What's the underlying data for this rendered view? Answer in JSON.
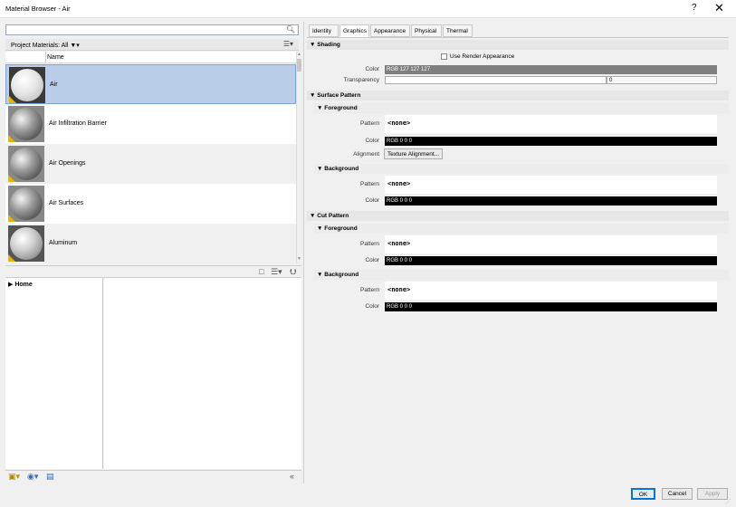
{
  "window": {
    "title": "Material Browser - Air",
    "help_label": "?",
    "close_label": "✕"
  },
  "search": {
    "value": "",
    "placeholder": ""
  },
  "project_header": {
    "label": "Project Materials: All",
    "filter_icon": "filter-icon"
  },
  "list_header": {
    "name_col": "Name"
  },
  "materials": [
    {
      "name": "Air",
      "selected": true
    },
    {
      "name": "Air Infiltration Barrier",
      "selected": false
    },
    {
      "name": "Air Openings",
      "selected": false
    },
    {
      "name": "Air Surfaces",
      "selected": false
    },
    {
      "name": "Aluminum",
      "selected": false
    }
  ],
  "library": {
    "home_label": "Home"
  },
  "tabs": [
    {
      "label": "Identity",
      "active": false
    },
    {
      "label": "Graphics",
      "active": true
    },
    {
      "label": "Appearance",
      "active": false
    },
    {
      "label": "Physical",
      "active": false
    },
    {
      "label": "Thermal",
      "active": false
    }
  ],
  "shading": {
    "header": "Shading",
    "use_render_label": "Use Render Appearance",
    "color_label": "Color",
    "color_value": "RGB 127 127 127",
    "transparency_label": "Transparency",
    "transparency_value": "0"
  },
  "surface_pattern": {
    "header": "Surface Pattern",
    "foreground": {
      "header": "Foreground",
      "pattern_label": "Pattern",
      "pattern_value": "<none>",
      "color_label": "Color",
      "color_value": "RGB 0 0 0",
      "alignment_label": "Alignment",
      "alignment_button": "Texture Alignment..."
    },
    "background": {
      "header": "Background",
      "pattern_label": "Pattern",
      "pattern_value": "<none>",
      "color_label": "Color",
      "color_value": "RGB 0 0 0"
    }
  },
  "cut_pattern": {
    "header": "Cut Pattern",
    "foreground": {
      "header": "Foreground",
      "pattern_label": "Pattern",
      "pattern_value": "<none>",
      "color_label": "Color",
      "color_value": "RGB 0 0 0"
    },
    "background": {
      "header": "Background",
      "pattern_label": "Pattern",
      "pattern_value": "<none>",
      "color_label": "Color",
      "color_value": "RGB 0 0 0"
    }
  },
  "footer": {
    "ok": "OK",
    "cancel": "Cancel",
    "apply": "Apply"
  },
  "colors": {
    "shading_gray": "#7f7f7f",
    "black": "#000000",
    "selection": "#b9cde8"
  }
}
